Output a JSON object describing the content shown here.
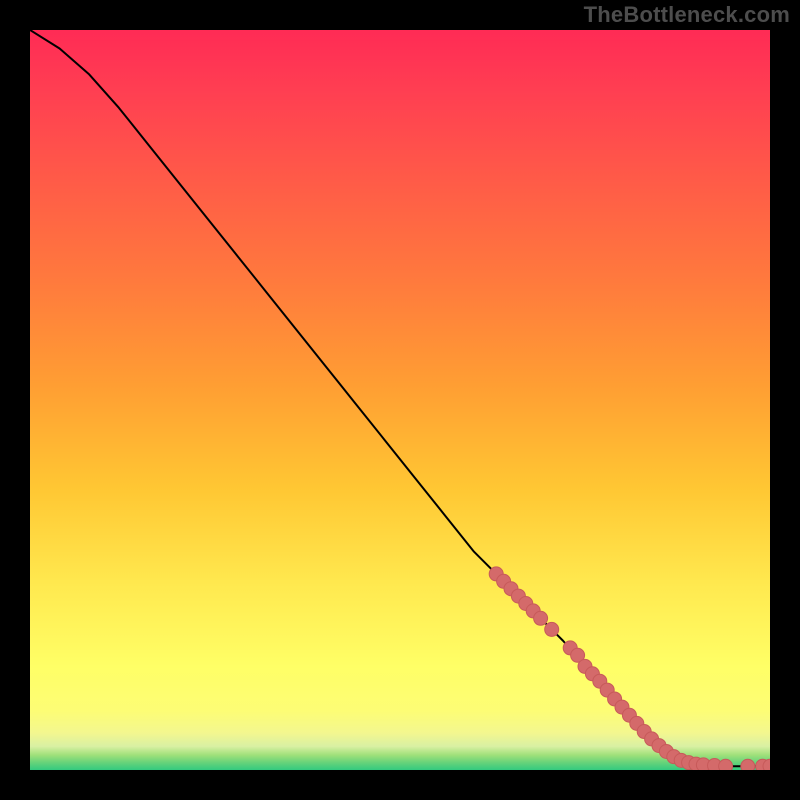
{
  "attribution": "TheBottleneck.com",
  "chart_data": {
    "type": "line",
    "title": "",
    "xlabel": "",
    "ylabel": "",
    "xlim": [
      0,
      100
    ],
    "ylim": [
      0,
      100
    ],
    "grid": false,
    "legend": false,
    "background_gradient": [
      "#33ca7f",
      "#d9f0a3",
      "#ffff66",
      "#ffcc33",
      "#ff8a33",
      "#ff4d4d",
      "#ff2b55"
    ],
    "series": [
      {
        "name": "curve",
        "stroke": "#000000",
        "x": [
          0,
          4,
          8,
          12,
          16,
          20,
          24,
          28,
          32,
          36,
          40,
          44,
          48,
          52,
          56,
          60,
          64,
          68,
          72,
          76,
          80,
          82,
          84,
          86,
          88,
          90,
          92,
          94,
          96,
          98,
          100
        ],
        "y": [
          100,
          97.5,
          94,
          89.5,
          84.5,
          79.5,
          74.5,
          69.5,
          64.5,
          59.5,
          54.5,
          49.5,
          44.5,
          39.5,
          34.5,
          29.5,
          25.5,
          21.5,
          17.5,
          13,
          8.5,
          6.3,
          4.2,
          2.5,
          1.3,
          0.8,
          0.6,
          0.5,
          0.5,
          0.5,
          0.5
        ]
      }
    ],
    "markers": [
      {
        "name": "highlight-points",
        "shape": "circle",
        "fill": "#d46a6a",
        "stroke": "#c75a5a",
        "r": 7,
        "points": [
          {
            "x": 63,
            "y": 26.5
          },
          {
            "x": 64,
            "y": 25.5
          },
          {
            "x": 65,
            "y": 24.5
          },
          {
            "x": 66,
            "y": 23.5
          },
          {
            "x": 67,
            "y": 22.5
          },
          {
            "x": 68,
            "y": 21.5
          },
          {
            "x": 69,
            "y": 20.5
          },
          {
            "x": 70.5,
            "y": 19
          },
          {
            "x": 73,
            "y": 16.5
          },
          {
            "x": 74,
            "y": 15.5
          },
          {
            "x": 75,
            "y": 14
          },
          {
            "x": 76,
            "y": 13
          },
          {
            "x": 77,
            "y": 12
          },
          {
            "x": 78,
            "y": 10.8
          },
          {
            "x": 79,
            "y": 9.6
          },
          {
            "x": 80,
            "y": 8.5
          },
          {
            "x": 81,
            "y": 7.4
          },
          {
            "x": 82,
            "y": 6.3
          },
          {
            "x": 83,
            "y": 5.2
          },
          {
            "x": 84,
            "y": 4.2
          },
          {
            "x": 85,
            "y": 3.3
          },
          {
            "x": 86,
            "y": 2.5
          },
          {
            "x": 87,
            "y": 1.8
          },
          {
            "x": 88,
            "y": 1.3
          },
          {
            "x": 89,
            "y": 1.0
          },
          {
            "x": 90,
            "y": 0.8
          },
          {
            "x": 91,
            "y": 0.7
          },
          {
            "x": 92.5,
            "y": 0.6
          },
          {
            "x": 94,
            "y": 0.5
          },
          {
            "x": 97,
            "y": 0.5
          },
          {
            "x": 99,
            "y": 0.5
          },
          {
            "x": 100,
            "y": 0.5
          }
        ]
      }
    ]
  }
}
